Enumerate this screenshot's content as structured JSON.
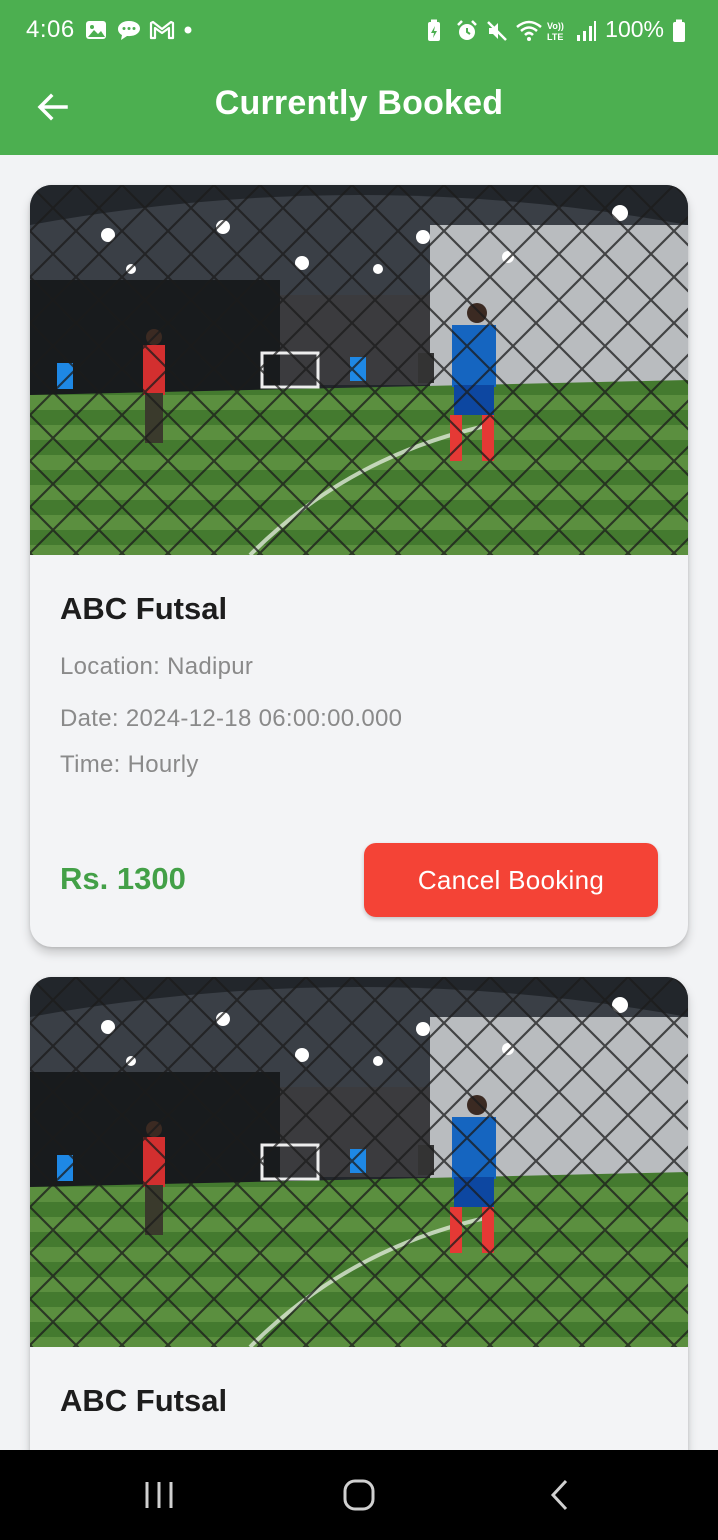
{
  "status_bar": {
    "time": "4:06",
    "battery": "100%",
    "left_icons": [
      "gallery-icon",
      "chat-icon",
      "gmail-icon",
      "dot-icon"
    ],
    "right_icons": [
      "battery-saver-icon",
      "alarm-icon",
      "mute-icon",
      "wifi-icon",
      "volte-icon",
      "signal-icon",
      "battery-icon"
    ]
  },
  "app_bar": {
    "title": "Currently Booked",
    "back_icon": "arrow-left-icon"
  },
  "bookings": [
    {
      "name": "ABC Futsal",
      "location": "Location: Nadipur",
      "date": "Date: 2024-12-18 06:00:00.000",
      "time": "Time: Hourly",
      "price": "Rs. 1300",
      "cancel_label": "Cancel Booking"
    },
    {
      "name": "ABC Futsal"
    }
  ],
  "colors": {
    "primary": "#4caf50",
    "price": "#43a047",
    "cancel": "#f44336",
    "background": "#f2f3f5"
  },
  "nav_bar": {
    "icons": [
      "recents-icon",
      "home-icon",
      "back-icon"
    ]
  }
}
